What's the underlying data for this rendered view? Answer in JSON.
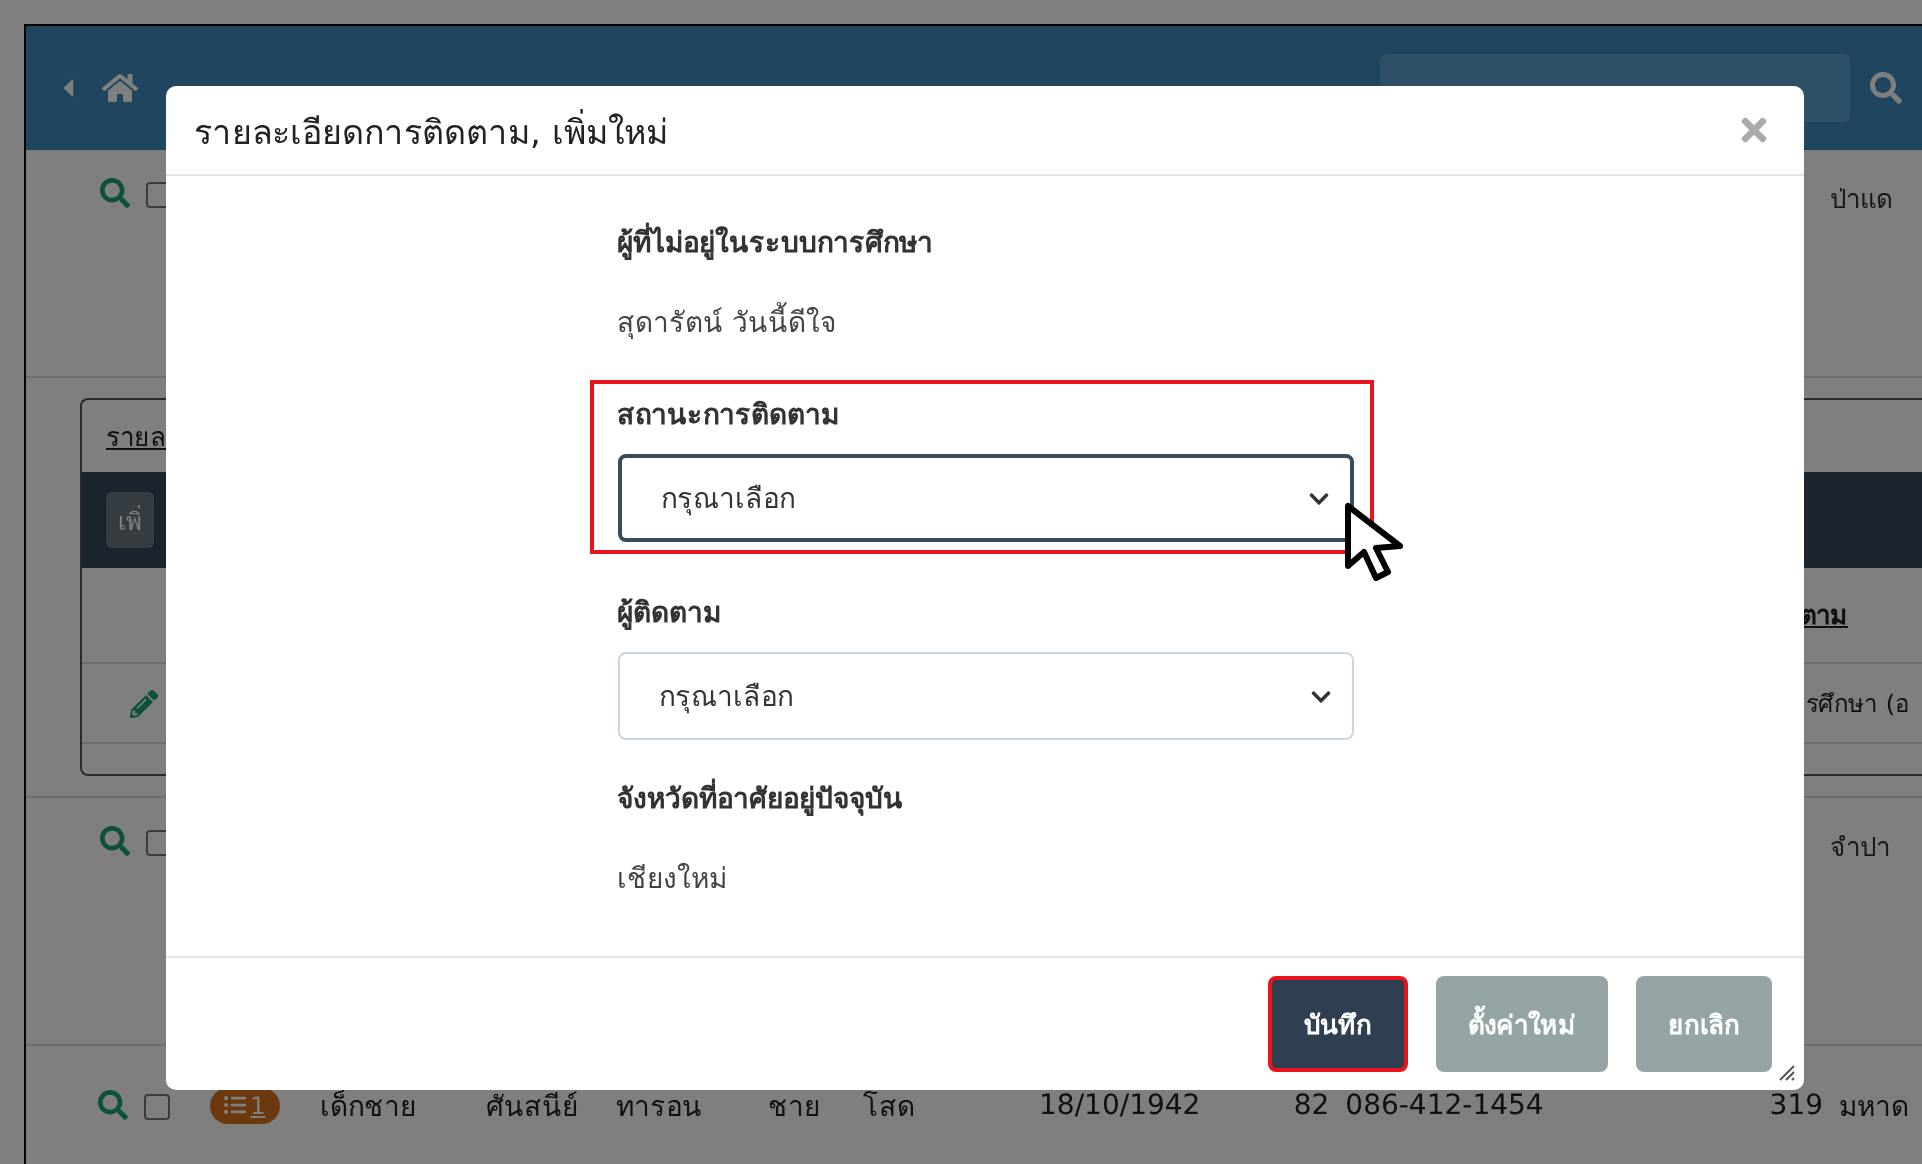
{
  "page": {
    "row_1": {
      "checked": false,
      "column_last": "ป่าแด"
    },
    "detail_card": {
      "tab": "รายล",
      "button": "เพิ่",
      "column_heading": "ตาม",
      "cell": "รศึกษา (อ"
    },
    "row_2": {
      "checked": false,
      "column_last": "จำปา"
    },
    "row_3": {
      "checked": false,
      "badge": "1",
      "cells": [
        "เด็กชาย",
        "ศันสนีย์",
        "ทารอน",
        "ชาย",
        "โสด",
        "18/10/1942",
        "82",
        "086-412-1454",
        "319",
        "มหาด"
      ]
    }
  },
  "dialog": {
    "title": "รายละเอียดการติดตาม, เพิ่มใหม่",
    "fields": [
      {
        "kind": "text",
        "label": "ผู้ที่ไม่อยู่ในระบบการศึกษา",
        "value": "สุดารัตน์ วันนี้ดีใจ"
      },
      {
        "kind": "select",
        "label": "สถานะการติดตาม",
        "value": "กรุณาเลือก",
        "focused": true,
        "highlighted": true
      },
      {
        "kind": "select",
        "label": "ผู้ติดตาม",
        "value": "กรุณาเลือก",
        "focused": false,
        "highlighted": false
      },
      {
        "kind": "text",
        "label": "จังหวัดที่อาศัยอยู่ปัจจุบัน",
        "value": "เชียงใหม่"
      }
    ],
    "buttons": [
      {
        "label": "บันทึก",
        "kind": "primary",
        "highlighted": true
      },
      {
        "label": "ตั้งค่าใหม่",
        "kind": "secondary",
        "highlighted": false
      },
      {
        "label": "ยกเลิก",
        "kind": "secondary",
        "highlighted": false
      }
    ]
  }
}
